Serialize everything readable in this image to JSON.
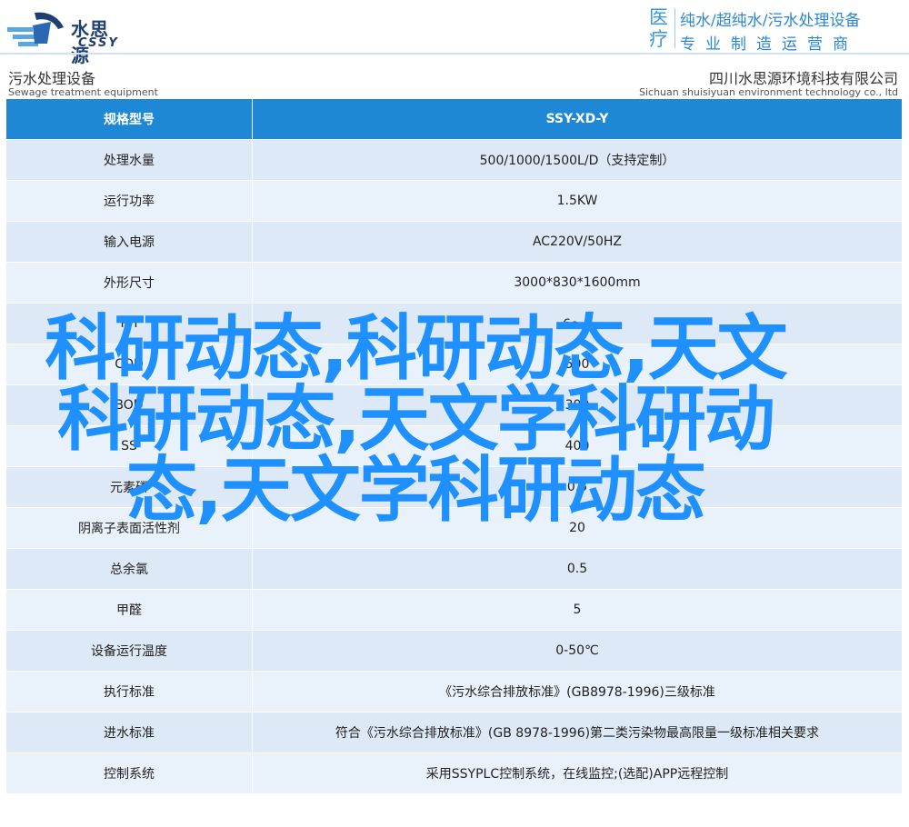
{
  "header": {
    "logo_cn": "水思源",
    "logo_en": "CSSY",
    "slogan_big": "医疗",
    "slogan_line1": "纯水/超纯水/污水处理设备",
    "slogan_line2": "专业制造运营商"
  },
  "subheader": {
    "left_cn": "污水处理设备",
    "left_en": "Sewage treatment equipment",
    "right_cn": "四川水思源环境科技有限公司",
    "right_en": "Sichuan shuisiyuan environment technology co., ltd"
  },
  "table": {
    "header": {
      "label": "规格型号",
      "value": "SSY-XD-Y"
    },
    "rows": [
      {
        "label": "处理水量",
        "value": "500/1000/1500L/D（支持定制）"
      },
      {
        "label": "运行功率",
        "value": "1.5KW"
      },
      {
        "label": "输入电源",
        "value": "AC220V/50HZ"
      },
      {
        "label": "外形尺寸",
        "value": "3000*830*1600mm"
      },
      {
        "label": "PH",
        "value": "6～9"
      },
      {
        "label": "COD",
        "value": "500"
      },
      {
        "label": "BOD",
        "value": "300"
      },
      {
        "label": "SS",
        "value": "400"
      },
      {
        "label": "元素磷",
        "value": "0.5"
      },
      {
        "label": "阴离子表面活性剂",
        "value": "20"
      },
      {
        "label": "总余氯",
        "value": "0.5"
      },
      {
        "label": "甲醛",
        "value": "5"
      },
      {
        "label": "设备运行温度",
        "value": "0-50℃"
      },
      {
        "label": "执行标准",
        "value": "《污水综合排放标准》(GB8978-1996)三级标准"
      },
      {
        "label": "进水标准",
        "value": "符合《污水综合排放标准》(GB 8978-1996)第二类污染物最高限量一级标准相关要求"
      },
      {
        "label": "控制系统",
        "value": "采用SSYPLC控制系统，在线监控;(选配)APP远程控制"
      }
    ]
  },
  "overlay_text": "科研动态,科研动态,天文科研动态,天文学科研动态,天文学科研动态",
  "colors": {
    "header_row": "#1e88d6",
    "row_light": "#e9f1fa",
    "row_dark": "#dde9f6",
    "overlay": "#1e90ff"
  }
}
